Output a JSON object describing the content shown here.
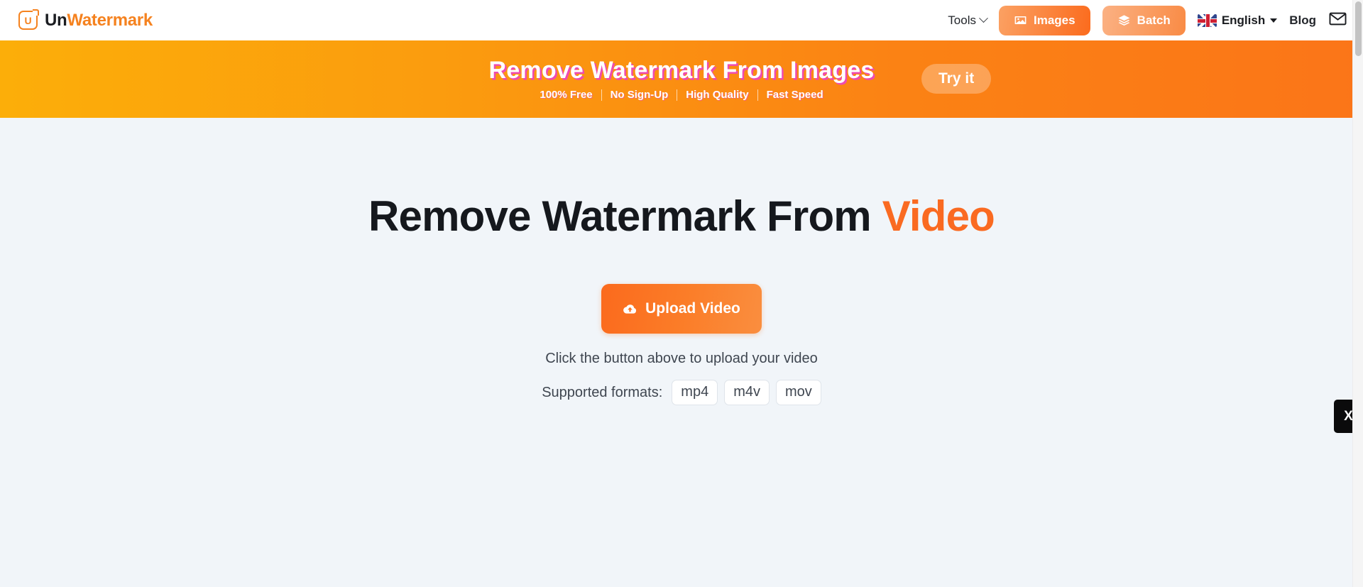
{
  "header": {
    "logo": {
      "icon": "unwatermark-logo-icon",
      "mark_letter": "U",
      "text_primary": "Un",
      "text_accent": "Watermark"
    },
    "nav": {
      "tools_label": "Tools",
      "tools_icon": "chevron-down-icon",
      "images_label": "Images",
      "images_icon": "image-icon",
      "batch_label": "Batch",
      "batch_icon": "layers-icon",
      "language_label": "English",
      "language_flag_icon": "uk-flag-icon",
      "language_chevron_icon": "chevron-down-icon",
      "blog_label": "Blog",
      "mail_icon": "envelope-icon"
    }
  },
  "banner": {
    "title": "Remove Watermark From Images",
    "features": [
      "100% Free",
      "No Sign-Up",
      "High Quality",
      "Fast Speed"
    ],
    "cta_label": "Try it",
    "gradient_start": "#FCAE09",
    "gradient_end": "#FB7518",
    "title_shadow_color": "#EF4BB0"
  },
  "main": {
    "title_primary": "Remove Watermark From",
    "title_accent": "Video",
    "accent_color": "#FA6A21",
    "upload_button_label": "Upload Video",
    "upload_button_icon": "cloud-upload-icon",
    "hint": "Click the button above to upload your video",
    "formats_label": "Supported formats:",
    "formats": [
      "mp4",
      "m4v",
      "mov"
    ],
    "background_color": "#F1F5F9"
  },
  "side_widget": {
    "icon": "x-close-icon",
    "label": "X"
  },
  "scrollbar": {
    "name": "vertical-scrollbar"
  }
}
